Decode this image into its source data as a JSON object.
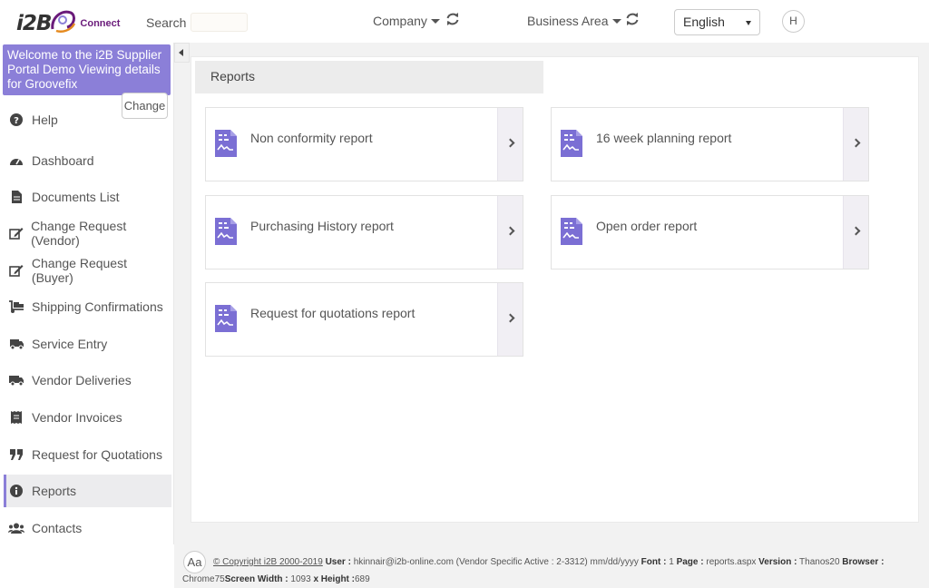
{
  "header": {
    "logo_text": "i2B",
    "logo_sub": "Connect",
    "search_label": "Search :",
    "search_value": "",
    "company_label": "Company",
    "business_area_label": "Business Area",
    "language": "English",
    "avatar_initial": "H"
  },
  "sidebar": {
    "welcome": "Welcome to the i2B Supplier Portal Demo Viewing details for Groovefix",
    "change_label": "Change",
    "items": [
      {
        "label": "Help",
        "icon": "question-circle-icon"
      },
      {
        "label": "Dashboard",
        "icon": "dashboard-icon"
      },
      {
        "label": "Documents List",
        "icon": "document-icon"
      },
      {
        "label": "Change Request (Vendor)",
        "icon": "edit-icon"
      },
      {
        "label": "Change Request (Buyer)",
        "icon": "edit-icon"
      },
      {
        "label": "Shipping Confirmations",
        "icon": "dolly-icon"
      },
      {
        "label": "Service Entry",
        "icon": "shipping-fast-icon"
      },
      {
        "label": "Vendor Deliveries",
        "icon": "truck-icon"
      },
      {
        "label": "Vendor Invoices",
        "icon": "receipt-icon"
      },
      {
        "label": "Request for Quotations",
        "icon": "quote-icon"
      },
      {
        "label": "Reports",
        "icon": "info-circle-icon",
        "active": true
      },
      {
        "label": "Contacts",
        "icon": "users-icon"
      }
    ]
  },
  "main": {
    "title": "Reports",
    "reports": [
      {
        "label": "Non conformity report"
      },
      {
        "label": "16 week planning report"
      },
      {
        "label": "Purchasing History report"
      },
      {
        "label": "Open order report"
      },
      {
        "label": "Request for quotations report"
      }
    ]
  },
  "footer": {
    "aa": "Aa",
    "copyright": "© Copyright i2B 2000-2019",
    "user_label": "User :",
    "user_value": "hkinnair@i2b-online.com (Vendor Specific Active : 2-3312)  mm/dd/yyyy",
    "font_label": "Font :",
    "font_value": "1",
    "page_label": "Page :",
    "page_value": "reports.aspx",
    "version_label": "Version :",
    "version_value": "Thanos20",
    "browser_label": "Browser :",
    "browser_value": "Chrome75",
    "screen_width_label": "Screen Width :",
    "screen_width_value": "1093",
    "height_label": "x Height :",
    "height_value": "689"
  },
  "colors": {
    "accent": "#8b7fd8",
    "brand_purple": "#6a1b7a",
    "icon_purple": "#7b6fd4"
  }
}
